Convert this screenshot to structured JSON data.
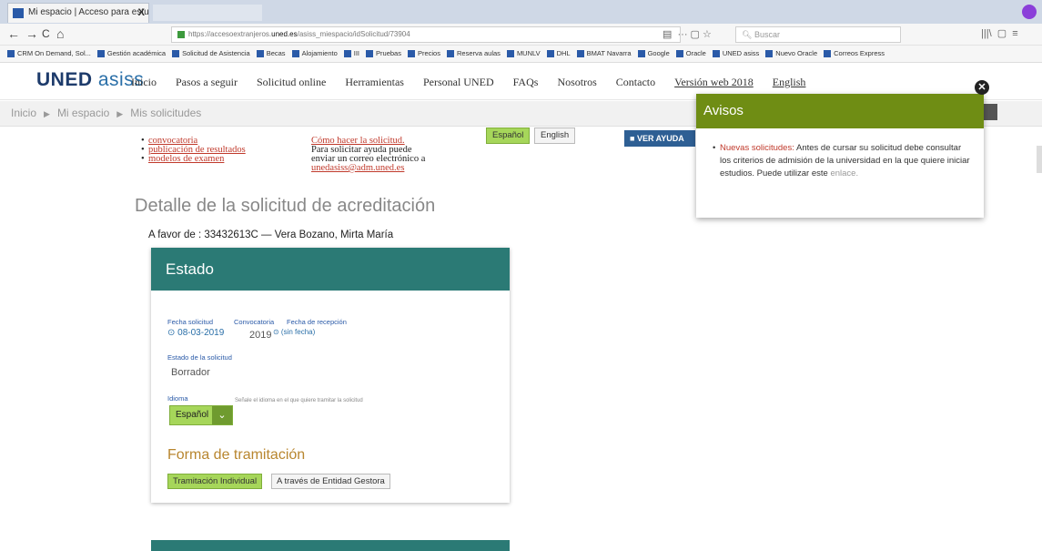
{
  "browser": {
    "tab_title": "Mi espacio | Acceso para estud",
    "tab_close": "X",
    "url_prefix": "https://accesoextranjeros.",
    "url_domain": "uned.es",
    "url_path": "/asiss_miespacio/idSolicitud/73904",
    "search_placeholder": "Buscar",
    "back": "←",
    "forward": "→",
    "reload": "C",
    "home": "⌂",
    "bookmarks": [
      "CRM On Demand, Sol...",
      "Gestión académica",
      "Solicitud de Asistencia",
      "Becas",
      "Alojamiento",
      "III",
      "Pruebas",
      "Precios",
      "Reserva aulas",
      "MUNLV",
      "DHL",
      "BMAT Navarra",
      "Google",
      "Oracle",
      "UNED asiss",
      "Nuevo Oracle",
      "Correos Express"
    ]
  },
  "site": {
    "logo_bold": "UNED",
    "logo_light": "asiss",
    "menu": [
      "Inicio",
      "Pasos a seguir",
      "Solicitud online",
      "Herramientas",
      "Personal UNED",
      "FAQs",
      "Nosotros",
      "Contacto"
    ],
    "menu_links": [
      "Versión web 2018",
      "English"
    ]
  },
  "breadcrumb": [
    "Inicio",
    "Mi espacio",
    "Mis solicitudes"
  ],
  "links": [
    "convocatoria",
    "publicación de resultados",
    "modelos de examen"
  ],
  "help": {
    "title": "Cómo hacer la solicitud.",
    "line1": "Para solicitar ayuda puede",
    "line2": "enviar un correo electrónico a",
    "email": "unedasiss@adm.uned.es"
  },
  "lang_buttons": [
    "Español",
    "English"
  ],
  "help_button": "VER AYUDA",
  "page_title": "Detalle de la solicitud de acreditación",
  "favor": "A favor de : 33432613C — Vera Bozano, Mirta María",
  "estado": {
    "header": "Estado",
    "fecha_solicitud_label": "Fecha solicitud",
    "fecha_solicitud": "⊙ 08-03-2019",
    "convocatoria_label": "Convocatoria",
    "convocatoria": "2019",
    "fecha_recepcion_label": "Fecha de recepción",
    "fecha_recepcion": "⊙ (sin fecha)",
    "estado_label": "Estado de la solicitud",
    "estado": "Borrador",
    "idioma_label": "Idioma",
    "idioma_hint": "Señale el idioma en el que quiere tramitar la solicitud",
    "idioma_value": "Español",
    "forma_title": "Forma de tramitación",
    "forma_options": [
      "Tramitación Individual",
      "A través de Entidad Gestora"
    ]
  },
  "avisos": {
    "title": "Avisos",
    "highlight": "Nuevas solicitudes:",
    "text": "Antes de cursar su solicitud debe consultar los criterios de admisión de la universidad en la que quiere iniciar estudios. Puede utilizar este",
    "link": "enlace."
  }
}
